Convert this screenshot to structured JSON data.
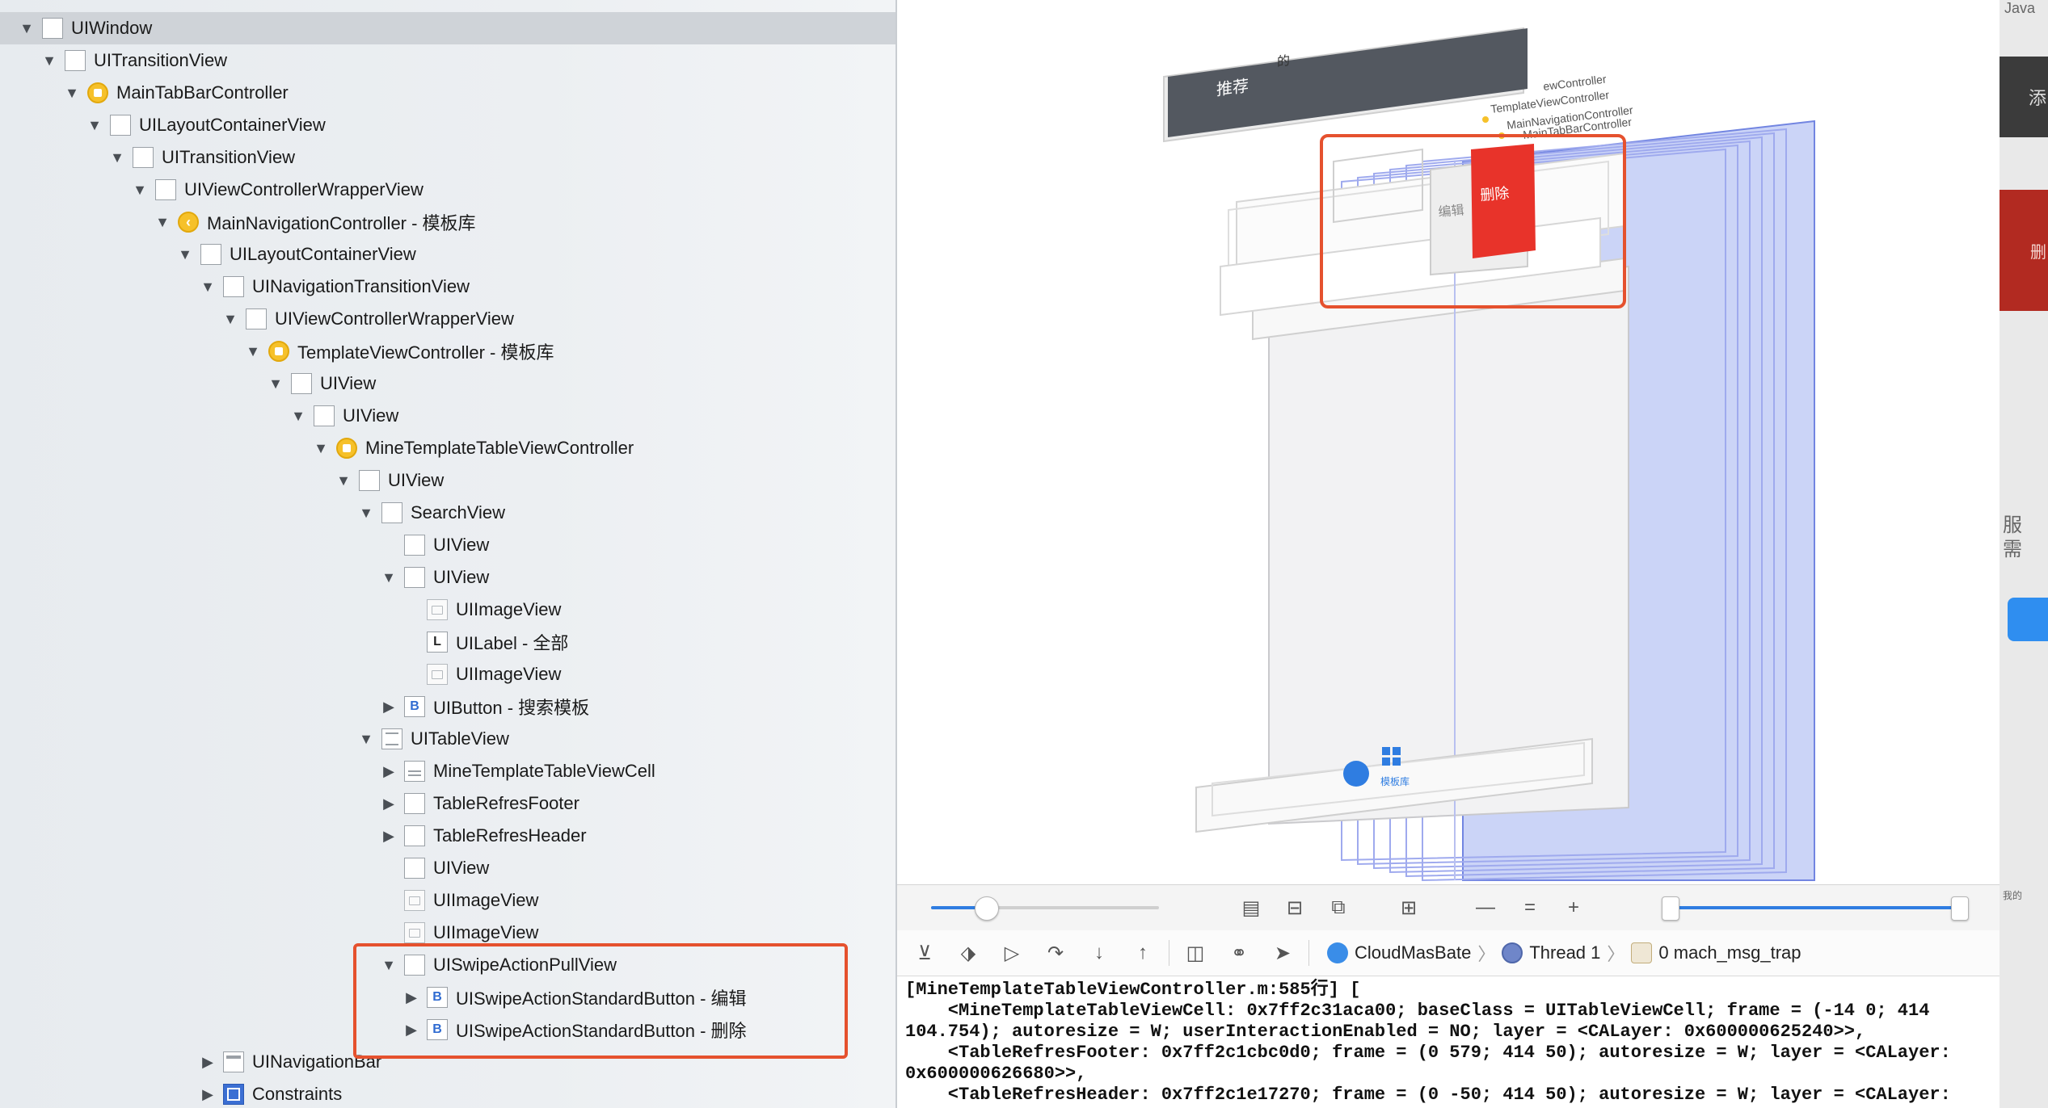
{
  "tree": [
    {
      "label": "UIWindow",
      "depth": 0,
      "icon": "view",
      "expanded": true,
      "selected": true
    },
    {
      "label": "UITransitionView",
      "depth": 1,
      "icon": "view",
      "expanded": true
    },
    {
      "label": "MainTabBarController",
      "depth": 2,
      "icon": "ctrl",
      "expanded": true
    },
    {
      "label": "UILayoutContainerView",
      "depth": 3,
      "icon": "view",
      "expanded": true
    },
    {
      "label": "UITransitionView",
      "depth": 4,
      "icon": "view",
      "expanded": true
    },
    {
      "label": "UIViewControllerWrapperView",
      "depth": 5,
      "icon": "view",
      "expanded": true
    },
    {
      "label": "MainNavigationController - 模板库",
      "depth": 6,
      "icon": "nav",
      "expanded": true
    },
    {
      "label": "UILayoutContainerView",
      "depth": 7,
      "icon": "view",
      "expanded": true
    },
    {
      "label": "UINavigationTransitionView",
      "depth": 8,
      "icon": "view",
      "expanded": true
    },
    {
      "label": "UIViewControllerWrapperView",
      "depth": 9,
      "icon": "view",
      "expanded": true
    },
    {
      "label": "TemplateViewController - 模板库",
      "depth": 10,
      "icon": "ctrl",
      "expanded": true
    },
    {
      "label": "UIView",
      "depth": 11,
      "icon": "view",
      "expanded": true
    },
    {
      "label": "UIView",
      "depth": 12,
      "icon": "view",
      "expanded": true
    },
    {
      "label": "MineTemplateTableViewController",
      "depth": 13,
      "icon": "ctrl",
      "expanded": true
    },
    {
      "label": "UIView",
      "depth": 14,
      "icon": "view",
      "expanded": true
    },
    {
      "label": "SearchView",
      "depth": 15,
      "icon": "view",
      "expanded": true
    },
    {
      "label": "UIView",
      "depth": 16,
      "icon": "view",
      "expanded": null
    },
    {
      "label": "UIView",
      "depth": 16,
      "icon": "view",
      "expanded": true
    },
    {
      "label": "UIImageView",
      "depth": 17,
      "icon": "img",
      "expanded": null
    },
    {
      "label": "UILabel - 全部",
      "depth": 17,
      "icon": "label",
      "glyph": "L",
      "expanded": null
    },
    {
      "label": "UIImageView",
      "depth": 17,
      "icon": "img",
      "expanded": null
    },
    {
      "label": "UIButton - 搜索模板",
      "depth": 16,
      "icon": "btn",
      "glyph": "B",
      "expanded": false
    },
    {
      "label": "UITableView",
      "depth": 15,
      "icon": "table",
      "expanded": true
    },
    {
      "label": "MineTemplateTableViewCell",
      "depth": 16,
      "icon": "cell",
      "expanded": false
    },
    {
      "label": "TableRefresFooter",
      "depth": 16,
      "icon": "view",
      "expanded": false
    },
    {
      "label": "TableRefresHeader",
      "depth": 16,
      "icon": "view",
      "expanded": false
    },
    {
      "label": "UIView",
      "depth": 16,
      "icon": "view",
      "expanded": null
    },
    {
      "label": "UIImageView",
      "depth": 16,
      "icon": "img",
      "expanded": null
    },
    {
      "label": "UIImageView",
      "depth": 16,
      "icon": "img",
      "expanded": null
    },
    {
      "label": "UISwipeActionPullView",
      "depth": 16,
      "icon": "view",
      "expanded": true
    },
    {
      "label": "UISwipeActionStandardButton - 编辑",
      "depth": 17,
      "icon": "btn",
      "glyph": "B",
      "expanded": false
    },
    {
      "label": "UISwipeActionStandardButton - 删除",
      "depth": 17,
      "icon": "btn",
      "glyph": "B",
      "expanded": false
    },
    {
      "label": "UINavigationBar",
      "depth": 8,
      "icon": "navbar",
      "expanded": false
    },
    {
      "label": "Constraints",
      "depth": 8,
      "icon": "constr",
      "expanded": false
    }
  ],
  "view3d": {
    "tab_labels": [
      "推荐",
      "的",
      "添加"
    ],
    "controller_labels": [
      "ewController",
      "TemplateViewController",
      "MainNavigationController",
      "MainTabBarController"
    ],
    "delete_label": "删除",
    "edit_label": "编辑",
    "tabbar_label": "模板库"
  },
  "debug_bar": {
    "scheme": "CloudMasBate",
    "thread": "Thread 1",
    "frame": "0 mach_msg_trap"
  },
  "console_lines": [
    "[MineTemplateTableViewController.m:585行] [",
    "    <MineTemplateTableViewCell: 0x7ff2c31aca00; baseClass = UITableViewCell; frame = (-14 0; 414",
    "104.754); autoresize = W; userInteractionEnabled = NO; layer = <CALayer: 0x600000625240>>,",
    "    <TableRefresFooter: 0x7ff2c1cbc0d0; frame = (0 579; 414 50); autoresize = W; layer = <CALayer:",
    "0x600000626680>>,",
    "    <TableRefresHeader: 0x7ff2c1e17270; frame = (0 -50; 414 50); autoresize = W; layer = <CALayer:"
  ],
  "right_edge": {
    "top_label": "Java",
    "dark_label": "添",
    "red_label": "删",
    "text1": "服",
    "text2": "需",
    "bottom_label": "我的"
  },
  "colors": {
    "accent": "#2f7de1",
    "annotation_red": "#e5512e",
    "delete_red": "#e8332a",
    "overlay_blue": "#c9d2f7"
  }
}
